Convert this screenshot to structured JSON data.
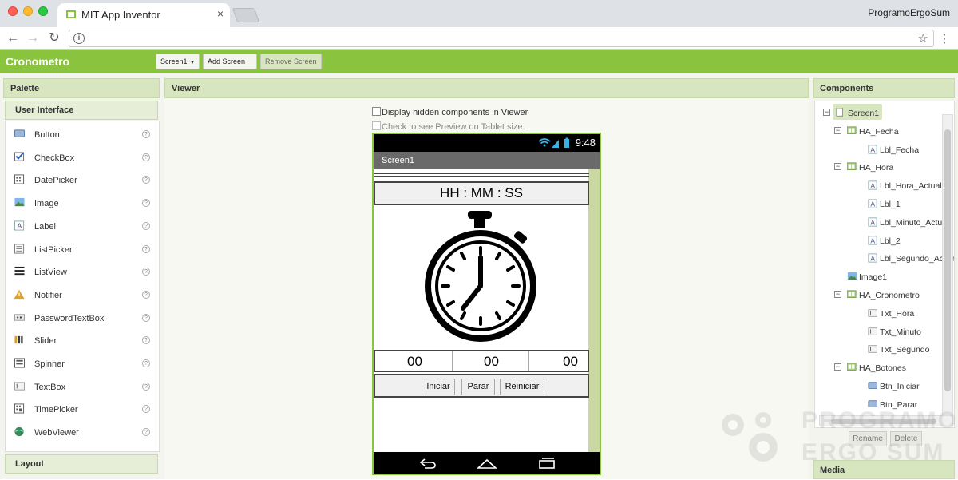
{
  "browser": {
    "tab_title": "MIT App Inventor",
    "tab_close": "×",
    "profile": "ProgramoErgoSum",
    "url": ""
  },
  "app": {
    "project_name": "Cronometro",
    "screen_select": "Screen1",
    "add_screen": "Add Screen ...",
    "remove_screen": "Remove Screen"
  },
  "palette": {
    "title": "Palette",
    "section": "User Interface",
    "items": [
      {
        "label": "Button",
        "icon": "button-icon"
      },
      {
        "label": "CheckBox",
        "icon": "checkbox-icon"
      },
      {
        "label": "DatePicker",
        "icon": "datepicker-icon"
      },
      {
        "label": "Image",
        "icon": "image-icon"
      },
      {
        "label": "Label",
        "icon": "label-icon"
      },
      {
        "label": "ListPicker",
        "icon": "listpicker-icon"
      },
      {
        "label": "ListView",
        "icon": "listview-icon"
      },
      {
        "label": "Notifier",
        "icon": "notifier-icon"
      },
      {
        "label": "PasswordTextBox",
        "icon": "passwordtextbox-icon"
      },
      {
        "label": "Slider",
        "icon": "slider-icon"
      },
      {
        "label": "Spinner",
        "icon": "spinner-icon"
      },
      {
        "label": "TextBox",
        "icon": "textbox-icon"
      },
      {
        "label": "TimePicker",
        "icon": "timepicker-icon"
      },
      {
        "label": "WebViewer",
        "icon": "webviewer-icon"
      }
    ],
    "help_glyph": "?",
    "layout_section": "Layout"
  },
  "viewer": {
    "title": "Viewer",
    "hidden_components": "Display hidden components in Viewer",
    "tablet_preview": "Check to see Preview on Tablet size.",
    "phone": {
      "time": "9:48",
      "screen_title": "Screen1",
      "clock_label": "HH  :  MM  :  SS",
      "counters": [
        "00",
        "00",
        "00"
      ],
      "buttons": [
        "Iniciar",
        "Parar",
        "Reiniciar"
      ]
    }
  },
  "components": {
    "title": "Components",
    "tree": [
      {
        "label": "Screen1",
        "level": 0,
        "toggle": "⊟",
        "icon": "screen-icon",
        "selected": true
      },
      {
        "label": "HA_Fecha",
        "level": 1,
        "toggle": "⊟",
        "icon": "arrangement-icon"
      },
      {
        "label": "Lbl_Fecha",
        "level": 2,
        "icon": "label-icon"
      },
      {
        "label": "HA_Hora",
        "level": 1,
        "toggle": "⊟",
        "icon": "arrangement-icon"
      },
      {
        "label": "Lbl_Hora_Actual",
        "level": 2,
        "icon": "label-icon"
      },
      {
        "label": "Lbl_1",
        "level": 2,
        "icon": "label-icon"
      },
      {
        "label": "Lbl_Minuto_Actual",
        "level": 2,
        "icon": "label-icon"
      },
      {
        "label": "Lbl_2",
        "level": 2,
        "icon": "label-icon"
      },
      {
        "label": "Lbl_Segundo_Actual",
        "level": 2,
        "icon": "label-icon"
      },
      {
        "label": "Image1",
        "level": 1,
        "icon": "image-icon"
      },
      {
        "label": "HA_Cronometro",
        "level": 1,
        "toggle": "⊟",
        "icon": "arrangement-icon"
      },
      {
        "label": "Txt_Hora",
        "level": 2,
        "icon": "textbox-icon"
      },
      {
        "label": "Txt_Minuto",
        "level": 2,
        "icon": "textbox-icon"
      },
      {
        "label": "Txt_Segundo",
        "level": 2,
        "icon": "textbox-icon"
      },
      {
        "label": "HA_Botones",
        "level": 1,
        "toggle": "⊟",
        "icon": "arrangement-icon"
      },
      {
        "label": "Btn_Iniciar",
        "level": 2,
        "icon": "button-icon"
      },
      {
        "label": "Btn_Parar",
        "level": 2,
        "icon": "button-icon"
      }
    ],
    "rename": "Rename",
    "delete": "Delete",
    "media": "Media"
  },
  "watermark": {
    "line1": "PROGRAMO",
    "line2": "ERGO SUM"
  },
  "colors": {
    "accent": "#8ac43f",
    "panel": "#d8e6c0"
  }
}
